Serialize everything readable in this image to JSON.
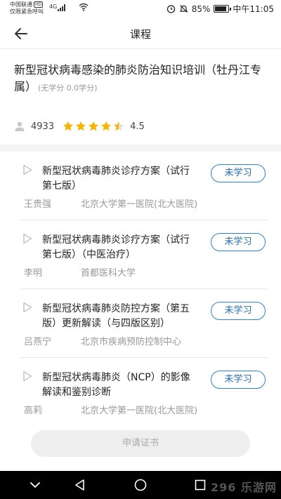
{
  "status_bar": {
    "carrier": "中国联通",
    "hd_badge": "HD",
    "emergency": "仅限紧急呼叫",
    "network": "4G",
    "battery": "85%",
    "time": "中午11:05"
  },
  "nav": {
    "title": "课程"
  },
  "course": {
    "title": "新型冠状病毒感染的肺炎防治知识培训（牡丹江专属）",
    "credit": "(无学分 0.0学分)",
    "learners": "4933",
    "rating": "4.5",
    "rating_value": 4.5,
    "rating_max": 5
  },
  "lessons": [
    {
      "title": "新型冠状病毒肺炎诊疗方案（试行第七版）",
      "status": "未学习",
      "teacher": "王贵强",
      "org": "北京大学第一医院(北大医院)"
    },
    {
      "title": "新型冠状病毒肺炎诊疗方案（试行第七版）（中医治疗）",
      "status": "未学习",
      "teacher": "李明",
      "org": "首都医科大学"
    },
    {
      "title": "新型冠状病毒肺炎防控方案（第五版）更新解读（与四版区别）",
      "status": "未学习",
      "teacher": "吕燕宁",
      "org": "北京市疾病预防控制中心"
    },
    {
      "title": "新型冠状病毒肺炎（NCP）的影像解读和鉴别诊断",
      "status": "未学习",
      "teacher": "高莉",
      "org": "北京大学第一医院(北大医院)"
    }
  ],
  "footer": {
    "apply_label": "申请证书"
  },
  "watermark": "296 乐游网",
  "colors": {
    "accent": "#2a86d0",
    "star": "#f5b400"
  }
}
